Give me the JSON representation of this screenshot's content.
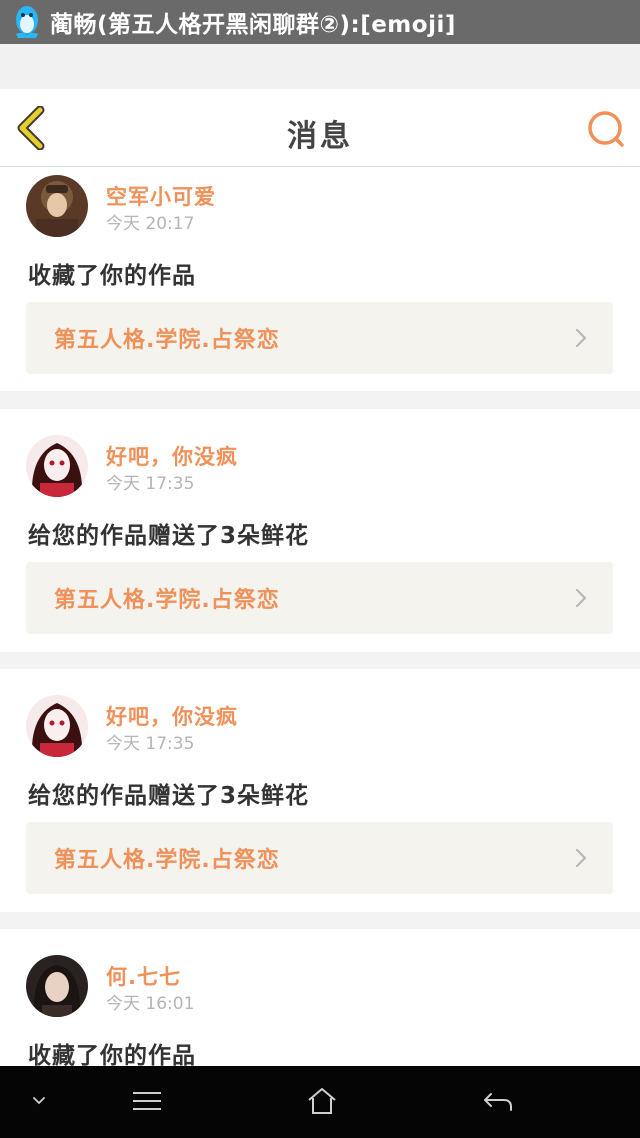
{
  "notification": {
    "text": "蔺畅(第五人格开黑闲聊群②):[emoji]",
    "icon": "qq-penguin-icon"
  },
  "header": {
    "title": "消息",
    "back_icon": "chevron-left-icon",
    "search_icon": "search-icon"
  },
  "colors": {
    "accent": "#f0915a",
    "back_icon": "#e6cf2a",
    "card_link_bg": "#f4f3ee",
    "nav_bg": "#050505"
  },
  "messages": [
    {
      "username": "空军小可爱",
      "time": "今天 20:17",
      "action": "收藏了你的作品",
      "work_title": "第五人格.学院.占祭恋"
    },
    {
      "username": "好吧，你没疯",
      "time": "今天 17:35",
      "action": "给您的作品赠送了3朵鲜花",
      "work_title": "第五人格.学院.占祭恋"
    },
    {
      "username": "好吧，你没疯",
      "time": "今天 17:35",
      "action": "给您的作品赠送了3朵鲜花",
      "work_title": "第五人格.学院.占祭恋"
    },
    {
      "username": "何.七七",
      "time": "今天 16:01",
      "action": "收藏了你的作品"
    }
  ],
  "system_nav": {
    "items": [
      "chevron-down-icon",
      "menu-icon",
      "home-icon",
      "back-arrow-icon"
    ]
  }
}
